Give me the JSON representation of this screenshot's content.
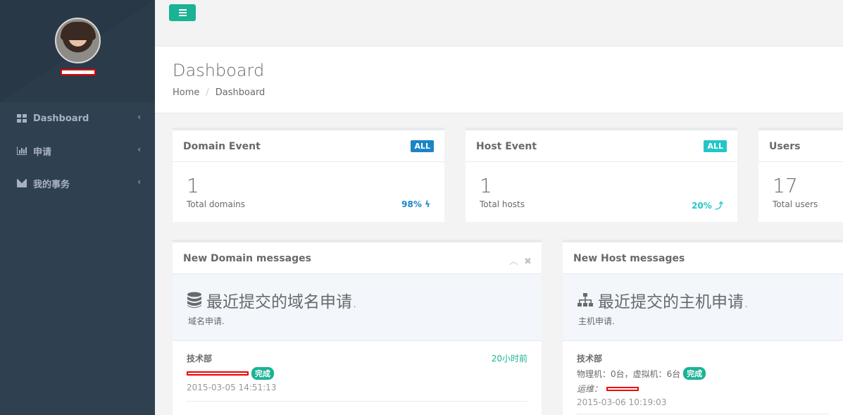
{
  "sidebar": {
    "items": [
      {
        "label": "Dashboard",
        "icon": "grid-icon"
      },
      {
        "label": "申请",
        "icon": "bar-chart-icon"
      },
      {
        "label": "我的事务",
        "icon": "envelope-icon"
      }
    ]
  },
  "page": {
    "title": "Dashboard",
    "breadcrumb": [
      "Home",
      "Dashboard"
    ]
  },
  "stats": [
    {
      "title": "Domain Event",
      "label": "ALL",
      "label_color": "#1c84c6",
      "value": "1",
      "caption": "Total domains",
      "percent": "98%",
      "percent_color": "#1c84c6",
      "trend_icon": "bolt-icon"
    },
    {
      "title": "Host Event",
      "label": "ALL",
      "label_color": "#23c6c8",
      "value": "1",
      "caption": "Total hosts",
      "percent": "20%",
      "percent_color": "#23c6c8",
      "trend_icon": "level-up-icon"
    },
    {
      "title": "Users",
      "value": "17",
      "caption": "Total users"
    }
  ],
  "domain_panel": {
    "title": "New Domain messages",
    "hero_title": "最近提交的域名申请.",
    "hero_sub": "域名申请.",
    "message": {
      "dept": "技术部",
      "status": "完成",
      "date": "2015-03-05 14:51:13",
      "time_ago": "20小时前"
    }
  },
  "host_panel": {
    "title": "New Host messages",
    "hero_title": "最近提交的主机申请.",
    "hero_sub": "主机申请.",
    "message": {
      "dept": "技术部",
      "detail": "物理机：0台，虚拟机：6台",
      "status": "完成",
      "ops_label": "运维：",
      "date": "2015-03-06 10:19:03"
    }
  },
  "colors": {
    "accent": "#1ab394",
    "sidebar": "#2f4050",
    "info": "#1c84c6",
    "teal": "#23c6c8"
  }
}
